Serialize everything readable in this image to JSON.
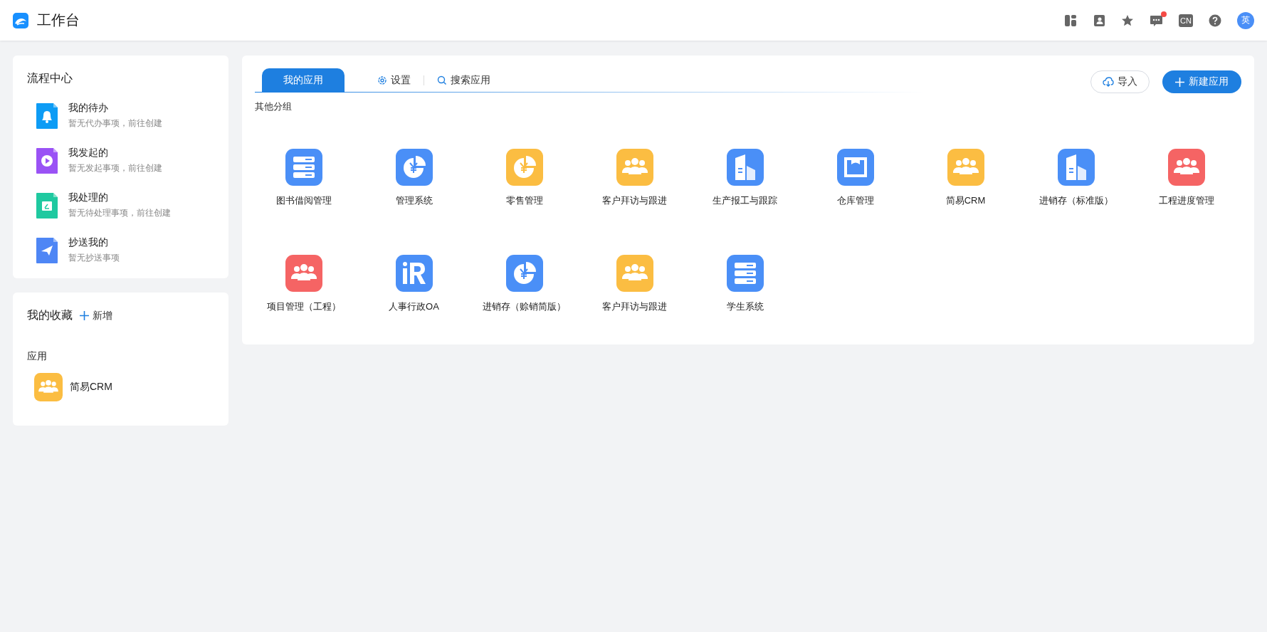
{
  "header": {
    "title": "工作台",
    "lang_badge": "CN",
    "notification_dot": true,
    "avatar": "英"
  },
  "process_center": {
    "title": "流程中心",
    "items": [
      {
        "title": "我的待办",
        "subtitle": "暂无代办事项，前往创建",
        "kind": "bell",
        "color": "#0d9cf5"
      },
      {
        "title": "我发起的",
        "subtitle": "暂无发起事项，前往创建",
        "kind": "play",
        "color": "#9a52f5"
      },
      {
        "title": "我处理的",
        "subtitle": "暂无待处理事项，前往创建",
        "kind": "tray",
        "color": "#1fc9a0"
      },
      {
        "title": "抄送我的",
        "subtitle": "暂无抄送事项",
        "kind": "plane",
        "color": "#4e86f5"
      }
    ]
  },
  "favorites": {
    "title": "我的收藏",
    "add_label": "新增",
    "group_label": "应用",
    "items": [
      {
        "name": "简易CRM",
        "kind": "people",
        "color": "#fbbd42"
      }
    ]
  },
  "apps_panel": {
    "tabs": [
      {
        "label": "我的应用",
        "selected": true
      }
    ],
    "settings_label": "设置",
    "search_label": "搜索应用",
    "import_label": "导入",
    "new_label": "新建应用",
    "group_title": "其他分组",
    "apps": [
      {
        "name": "图书借阅管理",
        "kind": "server",
        "color": "#4a8ff7"
      },
      {
        "name": "管理系统",
        "kind": "pie",
        "color": "#4a8ff7"
      },
      {
        "name": "零售管理",
        "kind": "pie",
        "color": "#fbbd42"
      },
      {
        "name": "客户拜访与跟进",
        "kind": "people",
        "color": "#fbbd42"
      },
      {
        "name": "生产报工与跟踪",
        "kind": "building",
        "color": "#4a8ff7"
      },
      {
        "name": "仓库管理",
        "kind": "warehouse",
        "color": "#4a8ff7"
      },
      {
        "name": "简易CRM",
        "kind": "people",
        "color": "#fbbd42"
      },
      {
        "name": "进销存（标准版）",
        "kind": "building",
        "color": "#4a8ff7"
      },
      {
        "name": "工程进度管理",
        "kind": "people",
        "color": "#f56464"
      },
      {
        "name": "项目管理（工程）",
        "kind": "people",
        "color": "#f56464"
      },
      {
        "name": "人事行政OA",
        "kind": "hr",
        "color": "#4a8ff7"
      },
      {
        "name": "进销存（赊销简版）",
        "kind": "pie",
        "color": "#4a8ff7"
      },
      {
        "name": "客户拜访与跟进",
        "kind": "people",
        "color": "#fbbd42"
      },
      {
        "name": "学生系统",
        "kind": "server",
        "color": "#4a8ff7"
      }
    ]
  }
}
